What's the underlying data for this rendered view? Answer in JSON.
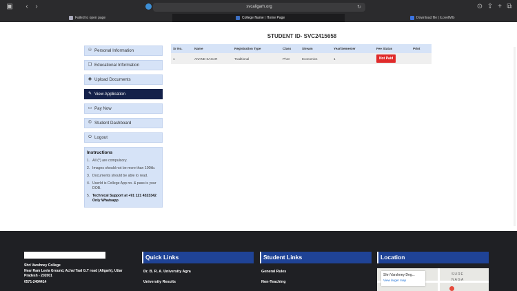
{
  "browser": {
    "url": "svcaligarh.org",
    "tabs": [
      {
        "label": "Failed to open page"
      },
      {
        "label": "College Name | Home Page"
      },
      {
        "label": "Download file | iLoveIMG"
      }
    ]
  },
  "page": {
    "student_id_title": "STUDENT ID- SVC2415658"
  },
  "sidebar": {
    "items": [
      {
        "label": "Personal Information",
        "icon": "user-icon"
      },
      {
        "label": "Educational Information",
        "icon": "book-icon"
      },
      {
        "label": "Upload Documents",
        "icon": "eye-icon"
      },
      {
        "label": "View Application",
        "icon": "edit-icon"
      },
      {
        "label": "Pay Now",
        "icon": "card-icon"
      },
      {
        "label": "Student Dashboard",
        "icon": "copyright-icon"
      },
      {
        "label": "Logout",
        "icon": "power-icon"
      }
    ]
  },
  "instructions": {
    "title": "Instructions",
    "items": [
      "All (*) are compulsory.",
      "Images should not be more than 100kb.",
      "Documents should be able to read.",
      "UserId is College App no. & pass is your DOB.",
      "Technical Support at +91 121 4323342 Only Whatsapp"
    ]
  },
  "table": {
    "headers": [
      "Sr No.",
      "Name",
      "Registration Type",
      "Class",
      "Stream",
      "Year/Semester",
      "Fee Status",
      "Print"
    ],
    "rows": [
      [
        "1",
        "ANAND SAGAR",
        "Traditional",
        "Ph.D",
        "Economics",
        "1",
        "Not Paid",
        ""
      ]
    ]
  },
  "footer": {
    "college_name": "Shri Varshney College",
    "address": "Near Ram Leela Ground, Achal Taal G.T road (Aligarh), Uttar Pradesh - 202001",
    "phone": "0571-2404414",
    "quick_links": {
      "title": "Quick Links",
      "items": [
        "Dr. B. R. A. University Agra",
        "University Results"
      ]
    },
    "student_links": {
      "title": "Student Links",
      "items": [
        "General Rules",
        "Non-Teaching"
      ]
    },
    "location": {
      "title": "Location",
      "map_title": "Shri Varshney Deg...",
      "map_link": "View larger map"
    }
  },
  "colors": {
    "sidebar_bg": "#d6e3f7",
    "sidebar_active": "#14214a",
    "footer_bg": "#1f2024",
    "footer_heading": "#1f4396",
    "not_paid": "#e02a2a"
  }
}
